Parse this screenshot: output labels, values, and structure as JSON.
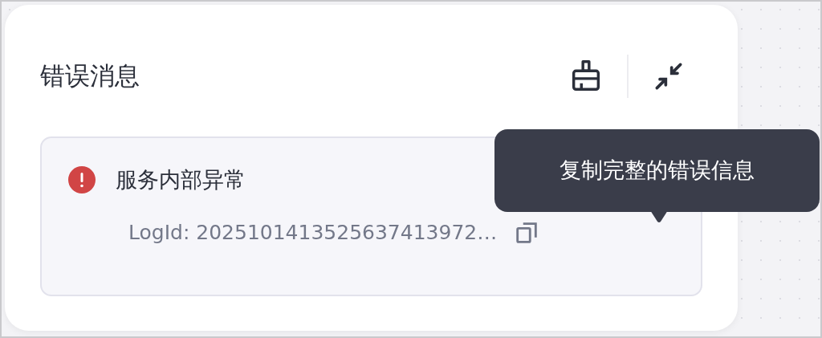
{
  "panel": {
    "title": "错误消息"
  },
  "error": {
    "message": "服务内部异常",
    "log_id": "LogId: 2025101413525637413972…"
  },
  "tooltip": {
    "text": "复制完整的错误信息"
  }
}
